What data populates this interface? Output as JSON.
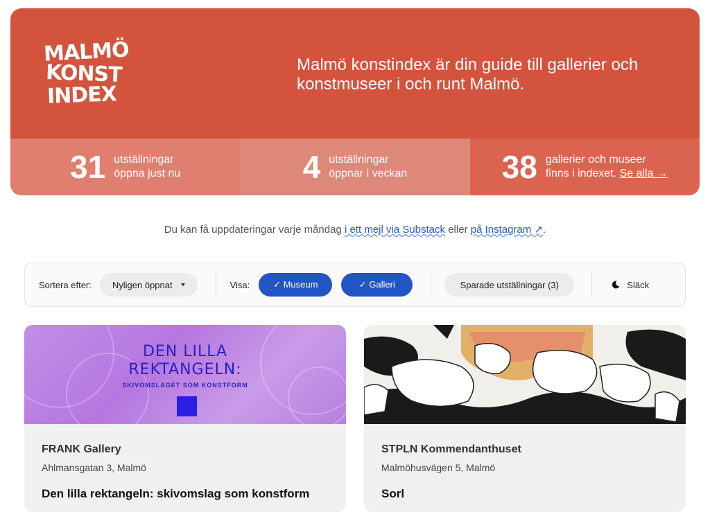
{
  "header": {
    "logo_lines": [
      "MALMÖ",
      "KONST",
      "INDEX"
    ],
    "tagline": "Malmö konstindex är din guide till gallerier och konstmuseer i och runt Malmö."
  },
  "stats": [
    {
      "number": "31",
      "line1": "utställningar",
      "line2": "öppna just nu"
    },
    {
      "number": "4",
      "line1": "utställningar",
      "line2": "öppnar i veckan"
    },
    {
      "number": "38",
      "line1": "gallerier och museer",
      "line2": "finns i indexet.",
      "link": "Se alla →"
    }
  ],
  "updates": {
    "prefix": "Du kan få uppdateringar varje måndag",
    "link1": "i ett mejl via Substack",
    "middle": "eller",
    "link2": "på Instagram ↗",
    "suffix": "."
  },
  "filters": {
    "sort_label": "Sortera efter:",
    "sort_value": "Nyligen öppnat",
    "show_label": "Visa:",
    "museum": "✓ Museum",
    "gallery": "✓ Galleri",
    "saved": "Sparade utställningar (3)",
    "dark_mode": "Släck"
  },
  "cards": [
    {
      "image_title_1": "DEN LILLA",
      "image_title_2": "REKTANGELN:",
      "image_subtitle": "SKIVOMSLAGET SOM KONSTFORM",
      "venue": "FRANK Gallery",
      "address": "Ahlmansgatan 3, Malmö",
      "title": "Den lilla rektangeln: skivomslag som konstform"
    },
    {
      "venue": "STPLN Kommendanthuset",
      "address": "Malmöhusvägen 5, Malmö",
      "title": "Sorl"
    }
  ],
  "colors": {
    "brand": "#d3533c",
    "accent_blue": "#2255c4"
  }
}
